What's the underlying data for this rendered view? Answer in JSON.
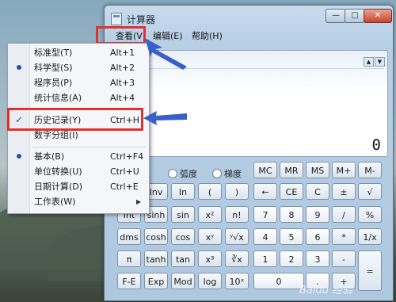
{
  "window": {
    "title": "计算器",
    "minimize_glyph": "—",
    "maximize_glyph": "□",
    "close_glyph": "✕"
  },
  "menubar": {
    "view": "查看(V)",
    "edit": "编辑(E)",
    "help": "帮助(H)"
  },
  "display": {
    "value": "0",
    "scroll_up": "▲",
    "scroll_down": "▼"
  },
  "angle_units": {
    "radians": "弧度",
    "gradians": "梯度"
  },
  "keys": {
    "row0": [
      "MC",
      "MR",
      "MS",
      "M+",
      "M-"
    ],
    "row1": [
      "Inv",
      "In",
      "(",
      ")",
      "←",
      "CE",
      "C",
      "±",
      "√"
    ],
    "row2": [
      "Int",
      "sinh",
      "sin",
      "x²",
      "n!",
      "7",
      "8",
      "9",
      "/",
      "%"
    ],
    "row3": [
      "dms",
      "cosh",
      "cos",
      "xʸ",
      "ʸ√x",
      "4",
      "5",
      "6",
      "*",
      "1/x"
    ],
    "row4": [
      "π",
      "tanh",
      "tan",
      "x³",
      "∛x",
      "1",
      "2",
      "3",
      "-",
      "="
    ],
    "row5": [
      "F-E",
      "Exp",
      "Mod",
      "log",
      "10ˣ",
      "0",
      ".",
      "+"
    ]
  },
  "dropdown": {
    "items": [
      {
        "label": "标准型(T)",
        "shortcut": "Alt+1"
      },
      {
        "label": "科学型(S)",
        "shortcut": "Alt+2"
      },
      {
        "label": "程序员(P)",
        "shortcut": "Alt+3"
      },
      {
        "label": "统计信息(A)",
        "shortcut": "Alt+4"
      },
      {
        "label": "历史记录(Y)",
        "shortcut": "Ctrl+H"
      },
      {
        "label": "数字分组(I)",
        "shortcut": ""
      },
      {
        "label": "基本(B)",
        "shortcut": "Ctrl+F4"
      },
      {
        "label": "单位转换(U)",
        "shortcut": "Ctrl+U"
      },
      {
        "label": "日期计算(D)",
        "shortcut": "Ctrl+E"
      },
      {
        "label": "工作表(W)",
        "shortcut": ""
      }
    ],
    "check_glyph": "✓",
    "submenu_glyph": "▶"
  },
  "colors": {
    "highlight_box": "#e2302e",
    "arrow": "#3a5fc8",
    "accent": "#2b4f9e"
  },
  "watermark": "Baidu 经验"
}
